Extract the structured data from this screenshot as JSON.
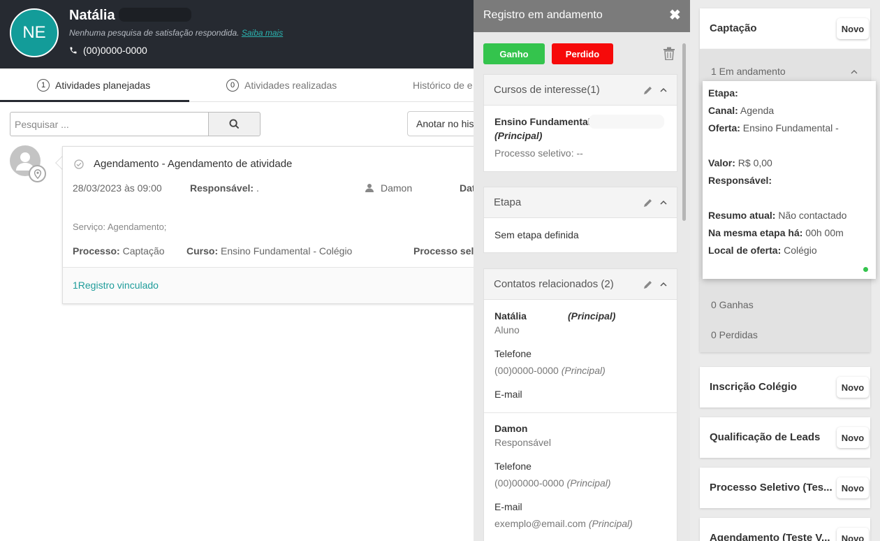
{
  "header": {
    "initials": "NE",
    "name": "Natália",
    "survey_text": "Nenhuma pesquisa de satisfação respondida.",
    "survey_link": "Saiba mais",
    "phone": "(00)0000-0000"
  },
  "tabs": [
    {
      "count": "1",
      "label": "Atividades planejadas"
    },
    {
      "count": "0",
      "label": "Atividades realizadas"
    },
    {
      "label": "Histórico de e"
    }
  ],
  "search": {
    "placeholder": "Pesquisar ..."
  },
  "note_button": "Anotar no his",
  "activity": {
    "title": "Agendamento - Agendamento de atividade",
    "date": "28/03/2023 às 09:00",
    "responsavel_label": "Responsável:",
    "responsavel_value": ".",
    "user": "Damon",
    "dat_label": "Dat",
    "servico": "Serviço: Agendamento;",
    "processo_label": "Processo:",
    "processo_value": "Captação",
    "curso_label": "Curso:",
    "curso_value": "Ensino Fundamental - Colégio",
    "processo_sel": "Processo sel",
    "linked": "1Registro vinculado"
  },
  "panel": {
    "title": "Registro em andamento",
    "ganho": "Ganho",
    "perdido": "Perdido",
    "cursos": {
      "header": "Cursos de interesse(1)",
      "course": "Ensino Fundamental -",
      "principal": "(Principal)",
      "processo": "Processo seletivo: --"
    },
    "etapa": {
      "header": "Etapa",
      "value": "Sem etapa definida"
    },
    "contatos": {
      "header": "Contatos relacionados (2)",
      "c1": {
        "name": "Natália",
        "principal": "(Principal)",
        "role": "Aluno",
        "tel_label": "Telefone",
        "tel": "(00)0000-0000",
        "tel_principal": "(Principal)",
        "email_label": "E-mail"
      },
      "c2": {
        "name": "Damon",
        "role": "Responsável",
        "tel_label": "Telefone",
        "tel": "(00)00000-0000",
        "tel_principal": "(Principal)",
        "email_label": "E-mail",
        "email": "exemplo@email.com",
        "email_principal": "(Principal)"
      }
    }
  },
  "right": {
    "novo": "Novo",
    "captacao": "Captação",
    "em_andamento": "1 Em andamento",
    "popup": {
      "etapa_label": "Etapa:",
      "canal_label": "Canal:",
      "canal_value": "Agenda",
      "oferta_label": "Oferta:",
      "oferta_value": "Ensino Fundamental -",
      "valor_label": "Valor:",
      "valor_value": "R$ 0,00",
      "responsavel_label": "Responsável:",
      "resumo_label": "Resumo atual:",
      "resumo_value": "Não contactado",
      "mesma_label": "Na mesma etapa há:",
      "mesma_value": "00h 00m",
      "local_label": "Local de oferta:",
      "local_value": "Colégio"
    },
    "ganhas": "0 Ganhas",
    "perdidas": "0 Perdidas",
    "cards": [
      "Inscrição Colégio",
      "Qualificação de Leads",
      "Processo Seletivo (Tes...",
      "Agendamento (Teste V..."
    ]
  }
}
